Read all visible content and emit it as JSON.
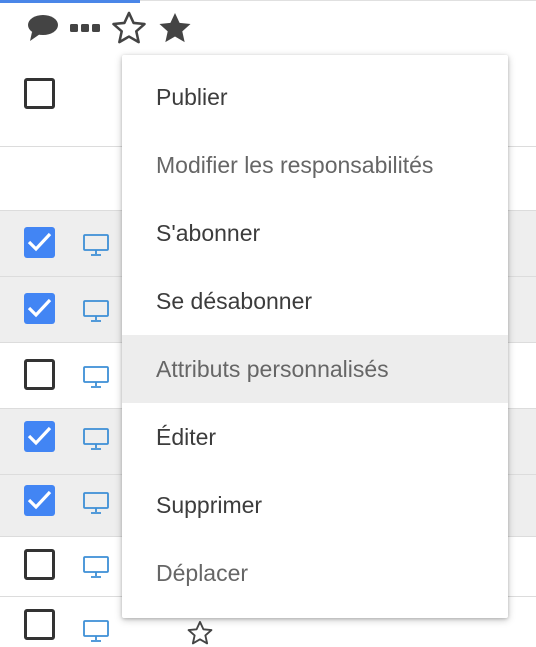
{
  "toolbar": {
    "icons": [
      "comment-icon",
      "more-icon",
      "star-outline-icon",
      "star-filled-icon"
    ]
  },
  "rows": [
    {
      "checked": false,
      "shaded": false,
      "icon": null
    },
    {
      "checked": false,
      "shaded": false,
      "icon": null
    },
    {
      "checked": true,
      "shaded": true,
      "icon": "monitor-icon"
    },
    {
      "checked": true,
      "shaded": true,
      "icon": "monitor-icon"
    },
    {
      "checked": false,
      "shaded": false,
      "icon": "monitor-icon"
    },
    {
      "checked": true,
      "shaded": true,
      "icon": "monitor-icon"
    },
    {
      "checked": true,
      "shaded": true,
      "icon": "monitor-icon"
    },
    {
      "checked": false,
      "shaded": false,
      "icon": "monitor-icon"
    },
    {
      "checked": false,
      "shaded": false,
      "icon": "monitor-icon"
    }
  ],
  "context_menu": {
    "items": [
      {
        "label": "Publier"
      },
      {
        "label": "Modifier les responsabilités"
      },
      {
        "label": "S'abonner"
      },
      {
        "label": "Se désabonner"
      },
      {
        "label": "Attributs personnalisés",
        "hovered": true
      },
      {
        "label": "Éditer"
      },
      {
        "label": "Supprimer"
      },
      {
        "label": "Déplacer"
      }
    ]
  },
  "colors": {
    "accent": "#4285f4",
    "monitor": "#3d8fd6",
    "row_shaded": "#eeeeee",
    "menu_hover": "#ededed"
  }
}
